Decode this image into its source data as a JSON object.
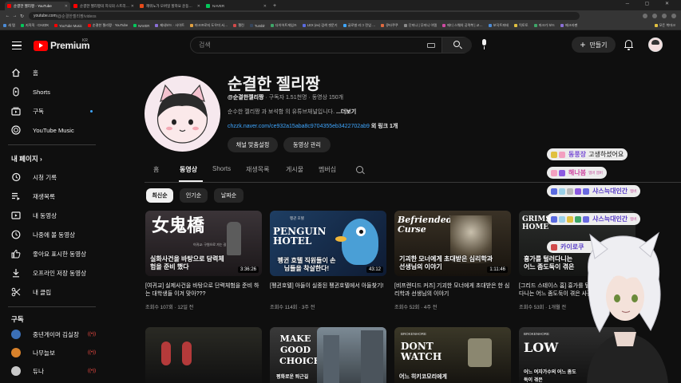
{
  "browser": {
    "tabs": [
      {
        "title": "순결한 젤리짱 - YouTube",
        "color": "#ff0000",
        "active": true
      },
      {
        "title": "순결한 젤리짱의 지식의 스트리…",
        "color": "#ff0000",
        "active": false
      },
      {
        "title": "깨워노가 오버일 할까요 운동…",
        "color": "#e64a19",
        "active": false
      },
      {
        "title": "NAVER",
        "color": "#03c75a",
        "active": false
      }
    ],
    "new_tab": "+",
    "url_host": "youtube.com",
    "url_path": "/@순결한젤리짱/videos",
    "bookmarks": [
      "새 탭",
      "지직직 · CHZZK",
      "YouTube Music",
      "순결한 젤리짱 · YouTube",
      "NAVER",
      "제네보드 · 사이트",
      "마크프로지 도우미 서…",
      "챌린",
      "Tumblr",
      "다이어트게임즈",
      "LEX (ex) 검색 겟문기",
      "글로벌 리그 전임 …",
      "큐타쿠쿠",
      "단미나 | 무미니 이템",
      "메디 스웨의 공략북 | 교…",
      "보닥트피테",
      "킥토토",
      "마크가 보드",
      "메크라펜",
      "모든 북마크"
    ]
  },
  "youtube": {
    "logo_text": "Premium",
    "logo_region": "KR",
    "search_placeholder": "검색",
    "create_label": "만들기"
  },
  "sidebar": {
    "items": [
      {
        "label": "홈",
        "icon": "home-icon"
      },
      {
        "label": "Shorts",
        "icon": "shorts-icon"
      },
      {
        "label": "구독",
        "icon": "subscriptions-icon"
      },
      {
        "label": "YouTube Music",
        "icon": "youtube-music-icon"
      }
    ],
    "you_header": "내 페이지",
    "you_chevron": "›",
    "you_items": [
      {
        "label": "시청 기록",
        "icon": "history-icon"
      },
      {
        "label": "재생목록",
        "icon": "playlists-icon"
      },
      {
        "label": "내 동영상",
        "icon": "your-videos-icon"
      },
      {
        "label": "나중에 볼 동영상",
        "icon": "watch-later-icon"
      },
      {
        "label": "좋아요 표시한 동영상",
        "icon": "liked-videos-icon"
      },
      {
        "label": "오프라인 저장 동영상",
        "icon": "downloads-icon"
      },
      {
        "label": "내 클립",
        "icon": "clips-icon"
      }
    ],
    "subs_header": "구독",
    "live_glyph": "((•))",
    "subscriptions": [
      {
        "name": "중년게이머 김실장",
        "avatar_color": "#3b6fb6",
        "live": true
      },
      {
        "name": "나무늘보",
        "avatar_color": "#d9822b",
        "live": true
      },
      {
        "name": "듀나",
        "avatar_color": "#c9c9c9",
        "live": true
      }
    ]
  },
  "channel": {
    "name": "순결한 젤리짱",
    "handle": "@순결한젤리짱",
    "subscribers": "구독자 1.51천명",
    "video_count": "동영상 150개",
    "description": "순수한 젤리짱 과 보석함 의 유튜브채널입니다.",
    "more_label": "...더보기",
    "link": "chzzk.naver.com/ce932a15aba8c9704355eb3422702ab9",
    "more_links": "외 링크 1개",
    "customize_button": "채널 맞춤설정",
    "manage_button": "동영상 관리"
  },
  "tabs": [
    "홈",
    "동영상",
    "Shorts",
    "재생목록",
    "게시물",
    "멤버십"
  ],
  "active_tab": "동영상",
  "sort_chips": [
    "최신순",
    "인기순",
    "날짜순"
  ],
  "videos": [
    {
      "title": "[여귀교] 실제사건을 바탕으로 단력체험을 준비 하는 대학생들 이겨 맞아???",
      "views": "조회수 107회",
      "age": "12일 전",
      "duration": "3:36:26",
      "thumb_caption": "실화사건을 바탕으로 담력체험을 준비 했다",
      "thumb_title": "女鬼橋",
      "thumb_sub": "이귀교: 구원으로 가는 길"
    },
    {
      "title": "[펭귄호텔] 아들이 실종된 펭귄호텔에서 아들찾기!",
      "views": "조회수 114회",
      "age": "3주 전",
      "duration": "43:12",
      "thumb_caption": "펭귄 호텔 직원들이 손님들을 착살한다!",
      "thumb_title": "PENGUIN HOTEL",
      "thumb_sub": "펭귄 호텔"
    },
    {
      "title": "[비프렌디드 커즈] 기괴한 모너에게 초대받은 한 심리학과 선생님의 이야기",
      "views": "조회수 52회",
      "age": "4주 전",
      "duration": "1:11:46",
      "thumb_caption": "기괴한 모너에게 초대받은 심리학과 선생님의 이야기",
      "thumb_title": "Befriended Curse",
      "thumb_sub": ""
    },
    {
      "title": "[그리드 스테이스 홈] 흉가를 털러 다니는 어느 좀도둑이 겪은 사건 (와",
      "views": "조회수 53회",
      "age": "1개월 전",
      "duration": "",
      "thumb_caption": "흉가를 털러다니는 어느 좀도둑이 겪은",
      "thumb_title": "GRIMS HOME",
      "thumb_sub": ""
    }
  ],
  "videos_row2": [
    {
      "thumb_caption": "",
      "thumb_title": ""
    },
    {
      "thumb_caption": "평화로운 퇴근길",
      "thumb_title": "MAKE GOOD CHOICES"
    },
    {
      "thumb_caption": "",
      "thumb_title": ""
    },
    {
      "thumb_caption": "어느 히키코모리에게",
      "thumb_title": "DONT WATCH",
      "thumb_sub": "BROKENHORE"
    },
    {
      "thumb_caption": "어느 여자가수의 어느 좀도둑이 겪은",
      "thumb_title": "LOW",
      "thumb_sub": "BROKENHORE"
    }
  ],
  "stream_overlay": {
    "messages": [
      {
        "name": "동풍장",
        "message": "고생하셨어요",
        "name_color": "#7a4fd6",
        "mini": ""
      },
      {
        "name": "해나봄",
        "message": "",
        "name_color": "#d04aa3",
        "mini": "멤버 멤버"
      },
      {
        "name": "샤스늑대인간",
        "message": "",
        "name_color": "#5a3fc8",
        "mini": "멤버"
      },
      {
        "name": "샤스늑대인간",
        "message": "",
        "name_color": "#5a3fc8",
        "mini": "멤버"
      },
      {
        "name": "카이로쿠",
        "message": "",
        "name_color": "#5a3fc8",
        "mini": ""
      }
    ]
  }
}
